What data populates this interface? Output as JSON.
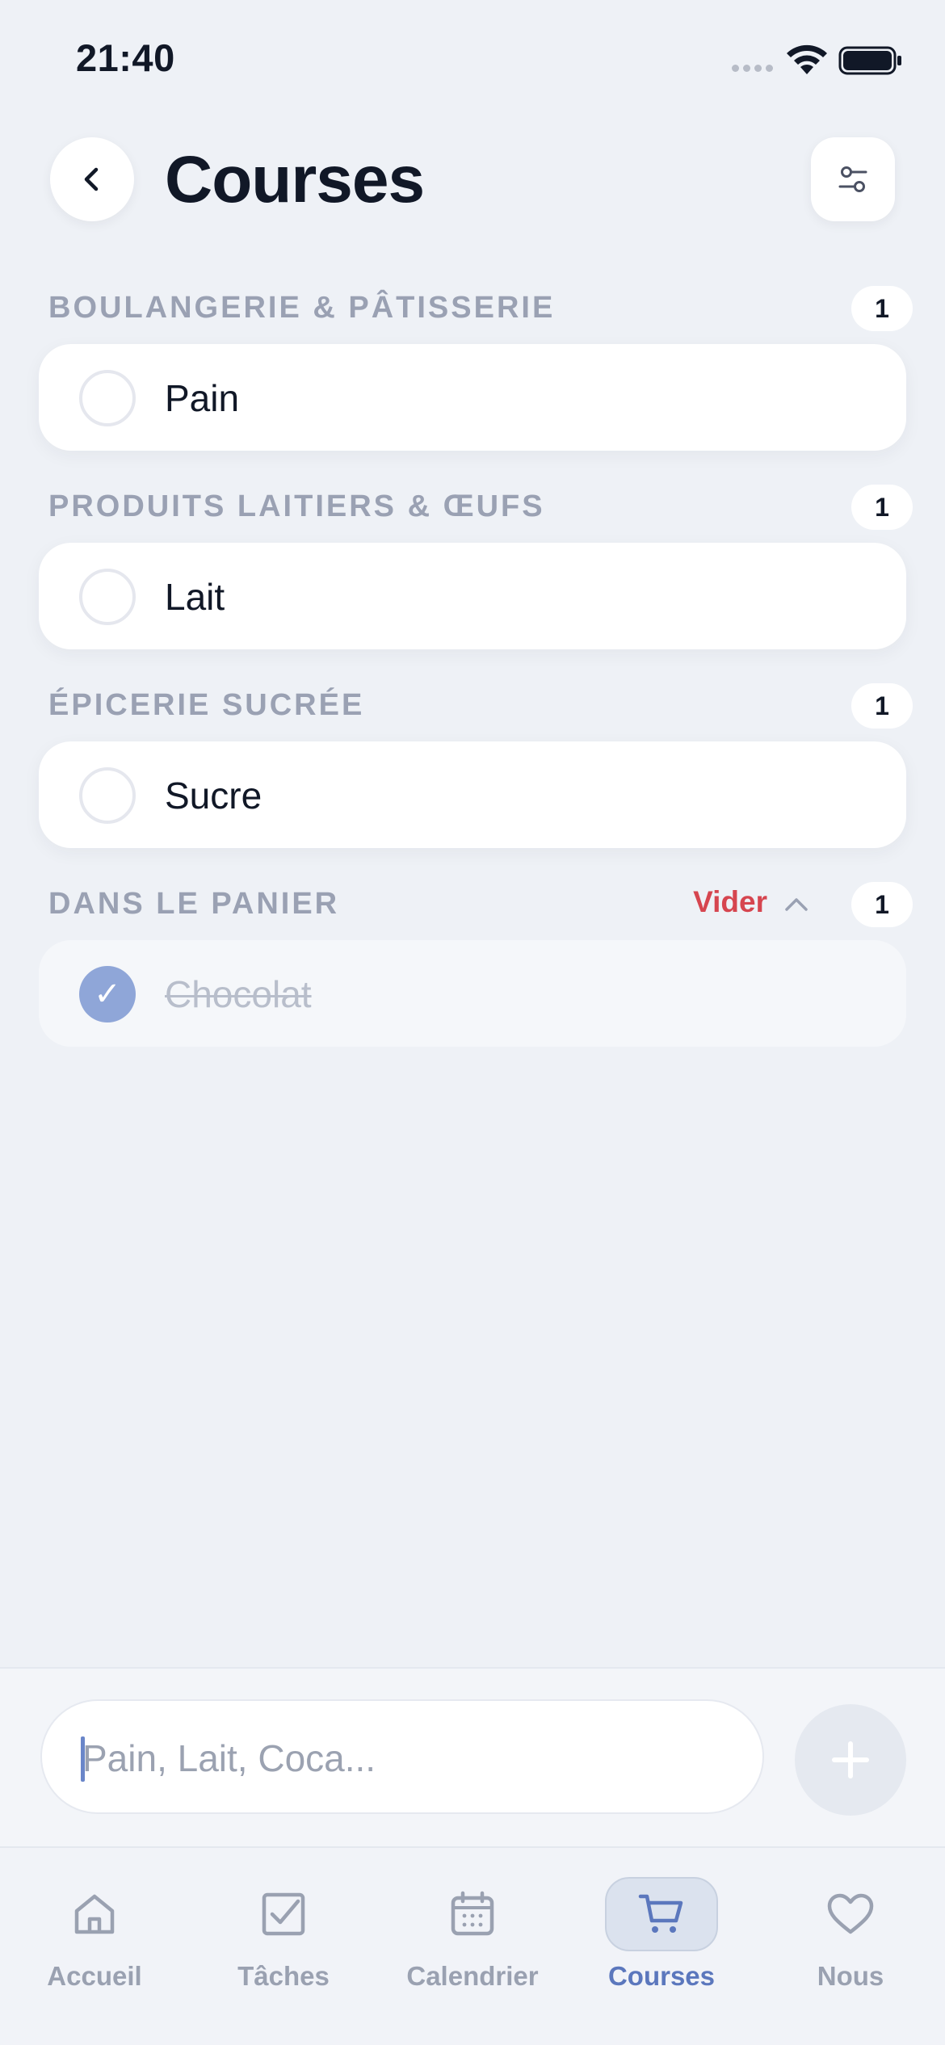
{
  "status_bar": {
    "time": "21:40"
  },
  "header": {
    "title": "Courses"
  },
  "sections": [
    {
      "title": "BOULANGERIE & PÂTISSERIE",
      "count": "1",
      "items": [
        {
          "label": "Pain",
          "checked": false
        }
      ]
    },
    {
      "title": "PRODUITS LAITIERS & ŒUFS",
      "count": "1",
      "items": [
        {
          "label": "Lait",
          "checked": false
        }
      ]
    },
    {
      "title": "ÉPICERIE SUCRÉE",
      "count": "1",
      "items": [
        {
          "label": "Sucre",
          "checked": false
        }
      ]
    }
  ],
  "basket": {
    "title": "DANS LE PANIER",
    "clear_label": "Vider",
    "count": "1",
    "items": [
      {
        "label": "Chocolat",
        "checked": true,
        "check_glyph": "✓"
      }
    ]
  },
  "composer": {
    "placeholder": "Pain, Lait, Coca..."
  },
  "tabs": [
    {
      "label": "Accueil",
      "icon": "home-icon",
      "active": false
    },
    {
      "label": "Tâches",
      "icon": "checkbox-icon",
      "active": false
    },
    {
      "label": "Calendrier",
      "icon": "calendar-icon",
      "active": false
    },
    {
      "label": "Courses",
      "icon": "cart-icon",
      "active": true
    },
    {
      "label": "Nous",
      "icon": "heart-icon",
      "active": false
    }
  ],
  "colors": {
    "background": "#eef1f6",
    "accent": "#5b77bd",
    "checked": "#8fa6d8",
    "danger": "#d6454f",
    "muted": "#9aa1b3"
  }
}
